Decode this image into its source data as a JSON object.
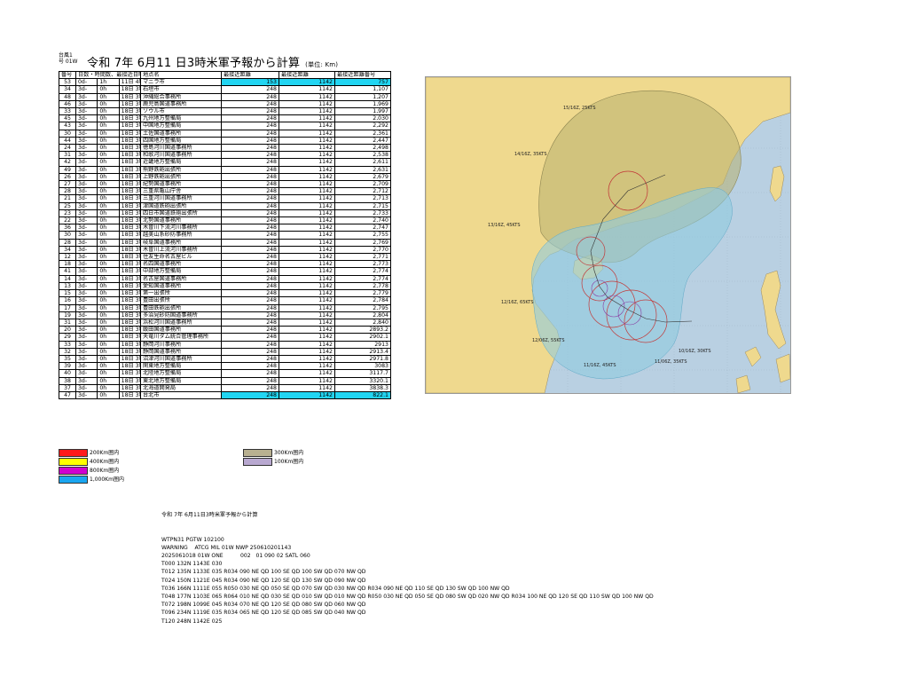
{
  "header": {
    "note_line1": "台風1",
    "note_line2": "号 01W",
    "title": "令和 7年 6月11 日3時米軍予報から計算",
    "unit": "(単位: Km)"
  },
  "table": {
    "columns": [
      "番号",
      "日数・時間数 最接近日時",
      "",
      "",
      "地点名",
      "最接近距離",
      "最接近時距離",
      "最接近距離番号"
    ],
    "header_labels": {
      "no": "番号",
      "times": "日数・時間数、最接近日時",
      "name": "地点名",
      "d1": "最接近距離",
      "d2": "最接近距離",
      "d3": "最接近距離番号"
    },
    "rows": [
      {
        "no": "53",
        "t1": "0d-",
        "t2": "1h",
        "t3": "11日 4時",
        "name": "マニラ市",
        "d1": "153",
        "d2": "1142",
        "d3": "757",
        "hl": true
      },
      {
        "no": "34",
        "t1": "3d-",
        "t2": "0h",
        "t3": "18日 3時",
        "name": "石垣市",
        "d1": "248",
        "d2": "1142",
        "d3": "1,107"
      },
      {
        "no": "48",
        "t1": "3d-",
        "t2": "0h",
        "t3": "18日 3時",
        "name": "沖縄総合事務所",
        "d1": "248",
        "d2": "1142",
        "d3": "1,207"
      },
      {
        "no": "46",
        "t1": "3d-",
        "t2": "0h",
        "t3": "18日 3時",
        "name": "鹿児島国道事務所",
        "d1": "248",
        "d2": "1142",
        "d3": "1,969"
      },
      {
        "no": "33",
        "t1": "3d-",
        "t2": "0h",
        "t3": "18日 3時",
        "name": "ソウル市",
        "d1": "248",
        "d2": "1142",
        "d3": "1,997"
      },
      {
        "no": "45",
        "t1": "3d-",
        "t2": "0h",
        "t3": "18日 3時",
        "name": "九州地方整備局",
        "d1": "248",
        "d2": "1142",
        "d3": "2,030"
      },
      {
        "no": "43",
        "t1": "3d-",
        "t2": "0h",
        "t3": "18日 3時",
        "name": "中国地方整備局",
        "d1": "248",
        "d2": "1142",
        "d3": "2,292"
      },
      {
        "no": "30",
        "t1": "3d-",
        "t2": "0h",
        "t3": "18日 3時",
        "name": "土佐国道事務所",
        "d1": "248",
        "d2": "1142",
        "d3": "2,361"
      },
      {
        "no": "44",
        "t1": "3d-",
        "t2": "0h",
        "t3": "18日 3時",
        "name": "四国地方整備局",
        "d1": "248",
        "d2": "1142",
        "d3": "2,447"
      },
      {
        "no": "24",
        "t1": "3d-",
        "t2": "0h",
        "t3": "18日 3時",
        "name": "徳島河川国道事務所",
        "d1": "248",
        "d2": "1142",
        "d3": "2,498"
      },
      {
        "no": "31",
        "t1": "3d-",
        "t2": "0h",
        "t3": "18日 3時",
        "name": "和歌河川国道事務所",
        "d1": "248",
        "d2": "1142",
        "d3": "2,538"
      },
      {
        "no": "42",
        "t1": "3d-",
        "t2": "0h",
        "t3": "18日 3時",
        "name": "近畿地方整備局",
        "d1": "248",
        "d2": "1142",
        "d3": "2,611"
      },
      {
        "no": "49",
        "t1": "3d-",
        "t2": "0h",
        "t3": "18日 3時",
        "name": "熊野鉄砲出張所",
        "d1": "248",
        "d2": "1142",
        "d3": "2,631"
      },
      {
        "no": "26",
        "t1": "3d-",
        "t2": "0h",
        "t3": "18日 3時",
        "name": "上野鉄砲出張所",
        "d1": "248",
        "d2": "1142",
        "d3": "2,679"
      },
      {
        "no": "27",
        "t1": "3d-",
        "t2": "0h",
        "t3": "18日 3時",
        "name": "紀勢国道事務所",
        "d1": "248",
        "d2": "1142",
        "d3": "2,709"
      },
      {
        "no": "28",
        "t1": "3d-",
        "t2": "0h",
        "t3": "18日 3時",
        "name": "三重県亀山庁舎",
        "d1": "248",
        "d2": "1142",
        "d3": "2,712"
      },
      {
        "no": "21",
        "t1": "3d-",
        "t2": "0h",
        "t3": "18日 3時",
        "name": "三重河川国道事務所",
        "d1": "248",
        "d2": "1142",
        "d3": "2,713"
      },
      {
        "no": "25",
        "t1": "3d-",
        "t2": "0h",
        "t3": "18日 3時",
        "name": "津国道鉄砲出張所",
        "d1": "248",
        "d2": "1142",
        "d3": "2,715"
      },
      {
        "no": "23",
        "t1": "3d-",
        "t2": "0h",
        "t3": "18日 3時",
        "name": "四日市国道鉄砲出張所",
        "d1": "248",
        "d2": "1142",
        "d3": "2,733"
      },
      {
        "no": "22",
        "t1": "3d-",
        "t2": "0h",
        "t3": "18日 3時",
        "name": "北勢国道事務所",
        "d1": "248",
        "d2": "1142",
        "d3": "2,740"
      },
      {
        "no": "36",
        "t1": "3d-",
        "t2": "0h",
        "t3": "18日 3時",
        "name": "木曽川下流河川事務所",
        "d1": "248",
        "d2": "1142",
        "d3": "2,747"
      },
      {
        "no": "30",
        "t1": "3d-",
        "t2": "0h",
        "t3": "18日 3時",
        "name": "越美山系砂防事務所",
        "d1": "248",
        "d2": "1142",
        "d3": "2,755"
      },
      {
        "no": "28",
        "t1": "3d-",
        "t2": "0h",
        "t3": "18日 3時",
        "name": "岐阜国道事務所",
        "d1": "248",
        "d2": "1142",
        "d3": "2,769"
      },
      {
        "no": "34",
        "t1": "3d-",
        "t2": "0h",
        "t3": "18日 3時",
        "name": "木曽川上流河川事務所",
        "d1": "248",
        "d2": "1142",
        "d3": "2,770"
      },
      {
        "no": "12",
        "t1": "3d-",
        "t2": "0h",
        "t3": "18日 3時",
        "name": "住友生命名古屋ビル",
        "d1": "248",
        "d2": "1142",
        "d3": "2,771"
      },
      {
        "no": "18",
        "t1": "3d-",
        "t2": "0h",
        "t3": "18日 3時",
        "name": "名四国道事務所",
        "d1": "248",
        "d2": "1142",
        "d3": "2,773"
      },
      {
        "no": "41",
        "t1": "3d-",
        "t2": "0h",
        "t3": "18日 3時",
        "name": "中部地方整備局",
        "d1": "248",
        "d2": "1142",
        "d3": "2,774"
      },
      {
        "no": "14",
        "t1": "3d-",
        "t2": "0h",
        "t3": "18日 3時",
        "name": "名古屋国道事務所",
        "d1": "248",
        "d2": "1142",
        "d3": "2,774"
      },
      {
        "no": "13",
        "t1": "3d-",
        "t2": "0h",
        "t3": "18日 3時",
        "name": "愛知国道事務所",
        "d1": "248",
        "d2": "1142",
        "d3": "2,778"
      },
      {
        "no": "15",
        "t1": "3d-",
        "t2": "0h",
        "t3": "18日 3時",
        "name": "第一出張所",
        "d1": "248",
        "d2": "1142",
        "d3": "2,779"
      },
      {
        "no": "16",
        "t1": "3d-",
        "t2": "0h",
        "t3": "18日 3時",
        "name": "豊田出張所",
        "d1": "248",
        "d2": "1142",
        "d3": "2,784"
      },
      {
        "no": "17",
        "t1": "3d-",
        "t2": "0h",
        "t3": "18日 3時",
        "name": "豊田鉄砲出張所",
        "d1": "248",
        "d2": "1142",
        "d3": "2,795"
      },
      {
        "no": "19",
        "t1": "3d-",
        "t2": "0h",
        "t3": "18日 3時",
        "name": "多治見砂防国道事務所",
        "d1": "248",
        "d2": "1142",
        "d3": "2,804"
      },
      {
        "no": "31",
        "t1": "3d-",
        "t2": "0h",
        "t3": "18日 3時",
        "name": "浜松河川国道事務所",
        "d1": "248",
        "d2": "1142",
        "d3": "2,840"
      },
      {
        "no": "20",
        "t1": "3d-",
        "t2": "0h",
        "t3": "18日 3時",
        "name": "飯田国道事務所",
        "d1": "248",
        "d2": "1142",
        "d3": "2893.2"
      },
      {
        "no": "29",
        "t1": "3d-",
        "t2": "0h",
        "t3": "18日 3時",
        "name": "天竜川ダム統合管理事務所",
        "d1": "248",
        "d2": "1142",
        "d3": "2902.1"
      },
      {
        "no": "33",
        "t1": "3d-",
        "t2": "0h",
        "t3": "18日 3時",
        "name": "静岡河川事務所",
        "d1": "248",
        "d2": "1142",
        "d3": "2913"
      },
      {
        "no": "32",
        "t1": "3d-",
        "t2": "0h",
        "t3": "18日 3時",
        "name": "静岡国道事務所",
        "d1": "248",
        "d2": "1142",
        "d3": "2913.4"
      },
      {
        "no": "35",
        "t1": "3d-",
        "t2": "0h",
        "t3": "18日 3時",
        "name": "沼津河川国道事務所",
        "d1": "248",
        "d2": "1142",
        "d3": "2971.8"
      },
      {
        "no": "39",
        "t1": "3d-",
        "t2": "0h",
        "t3": "18日 3時",
        "name": "関東地方整備局",
        "d1": "248",
        "d2": "1142",
        "d3": "3083"
      },
      {
        "no": "40",
        "t1": "3d-",
        "t2": "0h",
        "t3": "18日 3時",
        "name": "北陸地方整備局",
        "d1": "248",
        "d2": "1142",
        "d3": "3117.7"
      },
      {
        "no": "38",
        "t1": "3d-",
        "t2": "0h",
        "t3": "18日 3時",
        "name": "東北地方整備局",
        "d1": "248",
        "d2": "1142",
        "d3": "3320.1"
      },
      {
        "no": "37",
        "t1": "3d-",
        "t2": "0h",
        "t3": "18日 3時",
        "name": "北海道開発局",
        "d1": "248",
        "d2": "1142",
        "d3": "3838.3"
      },
      {
        "no": "47",
        "t1": "3d-",
        "t2": "0h",
        "t3": "18日 3時",
        "name": "台北市",
        "d1": "248",
        "d2": "1142",
        "d3": "822.1",
        "hl2": true
      }
    ]
  },
  "legend": [
    {
      "label": "200Km圏内",
      "color": "#ff1a1a"
    },
    {
      "label": "400Km圏内",
      "color": "#ffff00"
    },
    {
      "label": "800Km圏内",
      "color": "#d000d0"
    },
    {
      "label": "1,000Km圏内",
      "color": "#1aa6f0"
    },
    {
      "label": "300Km圏内",
      "color": "#b8b090"
    },
    {
      "label": "100Km圏内",
      "color": "#b8a8d0"
    }
  ],
  "map": {
    "labels": [
      "15/16Z, 25KTS",
      "14/16Z, 35KTS",
      "13/16Z, 45KTS",
      "12/16Z, 65KTS",
      "12/06Z, 55KTS",
      "11/16Z, 45KTS",
      "11/06Z, 35KTS",
      "10/16Z, 30KTS"
    ]
  },
  "notes": {
    "title": "令和 7年 6月11日3時米軍予報から計算",
    "lines": [
      "WTPN31 PGTW 102100",
      "WARNING    ATCG MIL 01W NWP 250610201143",
      "2025061018 01W ONE          002   01 090 02 SATL 060",
      "T000 132N 1143E 030",
      "T012 135N 1133E 035 R034 090 NE QD 100 SE QD 100 SW QD 070 NW QD",
      "T024 150N 1121E 045 R034 090 NE QD 120 SE QD 130 SW QD 090 NW QD",
      "T036 166N 1111E 055 R050 030 NE QD 050 SE QD 070 SW QD 030 NW QD R034 090 NE QD 110 SE QD 130 SW QD 100 NW QD",
      "T048 177N 1103E 065 R064 010 NE QD 030 SE QD 010 SW QD 010 NW QD R050 030 NE QD 050 SE QD 080 SW QD 020 NW QD R034 100 NE QD 120 SE QD 110 SW QD 100 NW QD",
      "T072 198N 1099E 045 R034 070 NE QD 120 SE QD 080 SW QD 060 NW QD",
      "T096 234N 1119E 035 R034 065 NE QD 120 SE QD 085 SW QD 040 NW QD",
      "T120 248N 1142E 025"
    ]
  }
}
